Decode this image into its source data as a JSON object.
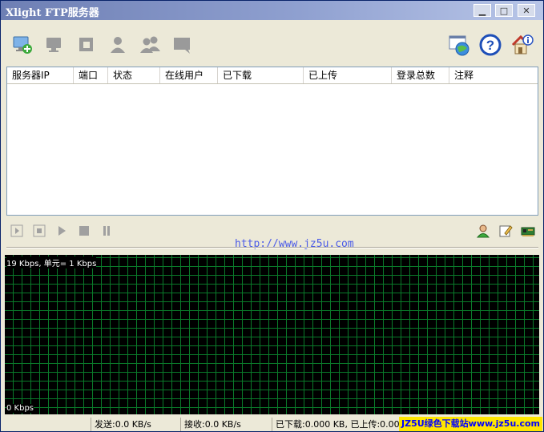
{
  "window": {
    "title": "Xlight FTP服务器",
    "minimize_icon": "minimize-icon",
    "maximize_icon": "maximize-icon",
    "close_icon": "close-icon"
  },
  "toolbar": {
    "left_buttons": [
      "add-server-icon",
      "remove-server-icon",
      "edit-server-icon",
      "user-icon",
      "users-icon",
      "message-icon"
    ],
    "right_buttons": [
      "web-settings-icon",
      "help-icon",
      "about-icon"
    ]
  },
  "table": {
    "columns": [
      "服务器IP",
      "端口",
      "状态",
      "在线用户",
      "已下载",
      "已上传",
      "登录总数",
      "注释"
    ],
    "rows": []
  },
  "controls": {
    "left": [
      "start-icon",
      "stop-icon",
      "play-icon",
      "stop-square-icon",
      "pause-icon"
    ],
    "right": [
      "user-manage-icon",
      "edit-note-icon",
      "network-card-icon"
    ]
  },
  "watermark_url": "http://www.jz5u.com",
  "graph": {
    "top_label": "19 Kbps, 单元= 1 Kbps",
    "bottom_label": "0 Kbps",
    "grid_color": "#0A7A2A",
    "background": "#000000"
  },
  "status": {
    "send": "发送:0.0 KB/s",
    "receive": "接收:0.0 KB/s",
    "transfer": "已下载:0.000 KB, 已上传:0.000"
  },
  "stamp": "JZ5U绿色下载站www.jz5u.com"
}
